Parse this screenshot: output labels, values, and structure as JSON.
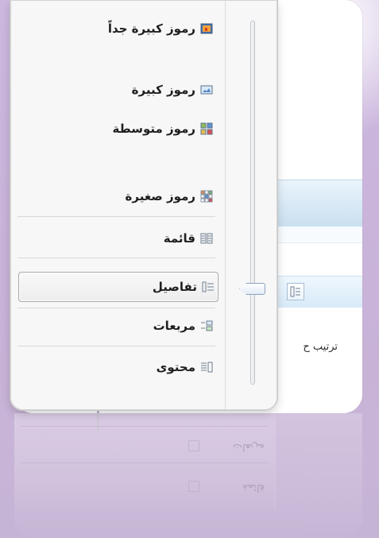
{
  "explorer": {
    "sort_label": "ترتيب ح"
  },
  "menu": {
    "items": [
      {
        "label": "رموز كبيرة جداً",
        "icon": "extra-large-icons-icon",
        "selected": false
      },
      {
        "label": "رموز كبيرة",
        "icon": "large-icons-icon",
        "selected": false
      },
      {
        "label": "رموز متوسطة",
        "icon": "medium-icons-icon",
        "selected": false
      },
      {
        "label": "رموز صغيرة",
        "icon": "small-icons-icon",
        "selected": false
      },
      {
        "label": "قائمة",
        "icon": "list-icon",
        "selected": false
      },
      {
        "label": "تفاصيل",
        "icon": "details-icon",
        "selected": true
      },
      {
        "label": "مربعات",
        "icon": "tiles-icon",
        "selected": false
      },
      {
        "label": "محتوى",
        "icon": "content-icon",
        "selected": false
      }
    ]
  },
  "colors": {
    "background": "#cdb9df",
    "menu_background": "#f7f7f7",
    "selection_border": "#a9a9a9",
    "toolbar": "#c9e0f1"
  }
}
